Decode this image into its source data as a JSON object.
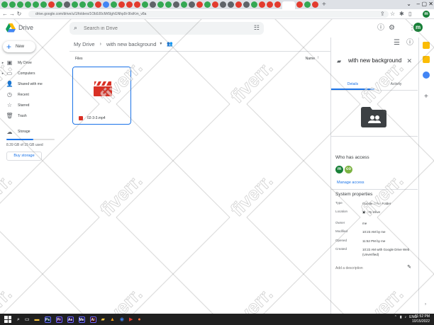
{
  "browser": {
    "url": "drive.google.com/drive/u/1/folders/1Ob9J0cMr5lghGNhp9i-9IxiKm_v8a",
    "tab_colors": [
      "#34a853",
      "#34a853",
      "#34a853",
      "#34a853",
      "#34a853",
      "#34a853",
      "#e33b2e",
      "#34a853",
      "#5f6368",
      "#34a853",
      "#34a853",
      "#34a853",
      "#e33b2e",
      "#4285f4",
      "#34a853",
      "#e33b2e",
      "#e33b2e",
      "#e33b2e",
      "#34a853",
      "#5f6368",
      "#34a853",
      "#34a853",
      "#5f6368",
      "#34a853",
      "#5f6368",
      "#e33b2e",
      "#34a853",
      "#e33b2e",
      "#5f6368",
      "#5f6368",
      "#e33b2e",
      "#5f6368",
      "#34a853",
      "#e33b2e",
      "#e33b2e",
      "#e33b2e",
      "#34a853",
      "#e33b2e",
      "#34a853",
      "#e33b2e"
    ],
    "profile_initial": "m"
  },
  "header": {
    "brand": "Drive",
    "search_placeholder": "Search in Drive",
    "account_initial": "m"
  },
  "sidebar": {
    "new_label": "New",
    "items": [
      {
        "label": "My Drive",
        "icon": "my-drive-icon",
        "has_caret": true
      },
      {
        "label": "Computers",
        "icon": "computers-icon",
        "has_caret": true
      },
      {
        "label": "Shared with me",
        "icon": "shared-icon",
        "has_caret": false
      },
      {
        "label": "Recent",
        "icon": "clock-icon",
        "has_caret": false
      },
      {
        "label": "Starred",
        "icon": "star-icon",
        "has_caret": false
      },
      {
        "label": "Trash",
        "icon": "trash-icon",
        "has_caret": false
      }
    ],
    "storage_label": "Storage",
    "storage_used_fraction": 0.56,
    "storage_text": "8.39 GB of 15 GB used",
    "buy_storage": "Buy storage"
  },
  "main": {
    "breadcrumb_root": "My Drive",
    "breadcrumb_current": "with new background",
    "files_label": "Files",
    "sort_label": "Name",
    "file": {
      "name": "02-3-3.mp4"
    }
  },
  "details": {
    "title": "with new background",
    "tab_details": "Details",
    "tab_activity": "Activity",
    "who_has_access": "Who has access",
    "avatars": [
      {
        "initial": "m",
        "color": "#188038"
      },
      {
        "initial": "co",
        "color": "#7cb342"
      }
    ],
    "manage_access": "Manage access",
    "system_properties": "System properties",
    "properties": [
      {
        "key": "Type",
        "value": "Google Drive Folder"
      },
      {
        "key": "Location",
        "value": "My Drive"
      },
      {
        "key": "Owner",
        "value": "me"
      },
      {
        "key": "Modified",
        "value": "10:23 AM by me"
      },
      {
        "key": "Opened",
        "value": "11:52 PM by me"
      },
      {
        "key": "Created",
        "value": "10:22 AM with Google Drive Web (Unverified)"
      }
    ],
    "description_placeholder": "Add a description"
  },
  "taskbar": {
    "apps": [
      {
        "label": "Ps",
        "color": "#001e36"
      },
      {
        "label": "Pr",
        "color": "#2a0a3d"
      },
      {
        "label": "Ae",
        "color": "#1f0f3d"
      },
      {
        "label": "Me",
        "color": "#14123d"
      },
      {
        "label": "Ai",
        "color": "#330000"
      }
    ],
    "language": "ENG",
    "time": "11:52 PM",
    "date": "10/15/2022"
  },
  "watermark": "fiverr."
}
